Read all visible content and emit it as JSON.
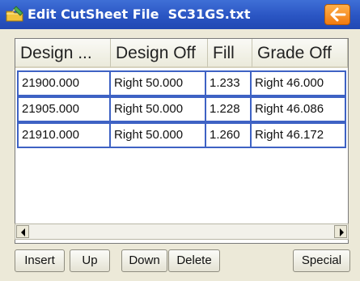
{
  "window": {
    "title": "Edit CutSheet File  SC31GS.txt",
    "icon": "folder-pencil-icon",
    "back_icon": "arrow-left-icon",
    "back_color": "#f58a1f"
  },
  "table": {
    "columns": [
      "Design ...",
      "Design Off",
      "Fill",
      "Grade Off"
    ],
    "rows": [
      [
        "21900.000",
        "Right 50.000",
        "1.233",
        "Right 46.000"
      ],
      [
        "21905.000",
        "Right 50.000",
        "1.228",
        "Right 46.086"
      ],
      [
        "21910.000",
        "Right 50.000",
        "1.260",
        "Right 46.172"
      ]
    ]
  },
  "scrollbar": {
    "left_icon": "arrow-left-small-icon",
    "right_icon": "arrow-right-small-icon"
  },
  "toolbar": {
    "insert_label": "Insert",
    "up_label": "Up",
    "down_label": "Down",
    "delete_label": "Delete",
    "special_label": "Special"
  }
}
